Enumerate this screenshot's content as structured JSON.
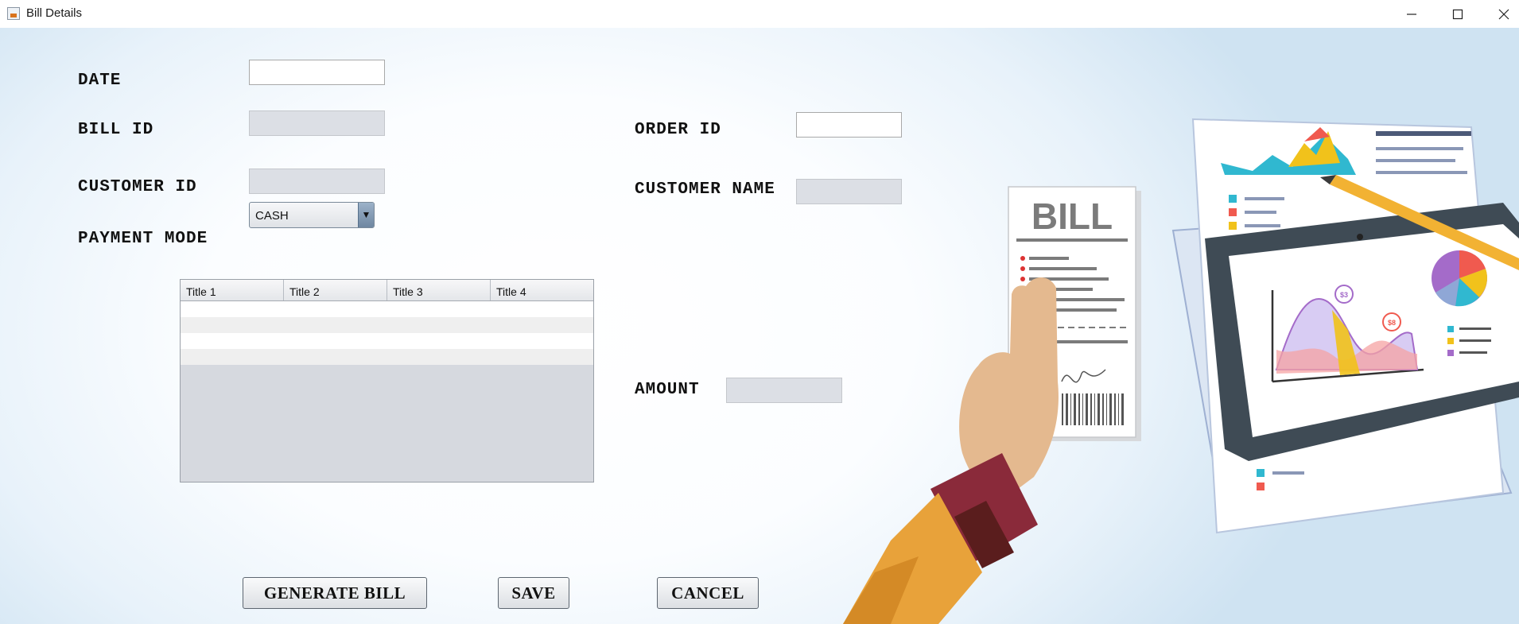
{
  "window": {
    "title": "Bill Details"
  },
  "form": {
    "date_label": "DATE",
    "date_value": "",
    "bill_id_label": "BILL ID",
    "bill_id_value": "",
    "customer_id_label": "CUSTOMER ID",
    "customer_id_value": "",
    "payment_mode_label": "PAYMENT MODE",
    "payment_mode_value": "CASH",
    "order_id_label": "ORDER ID",
    "order_id_value": "",
    "customer_name_label": "CUSTOMER NAME",
    "customer_name_value": "",
    "amount_label": "AMOUNT",
    "amount_value": ""
  },
  "table": {
    "columns": [
      "Title 1",
      "Title 2",
      "Title 3",
      "Title 4"
    ],
    "rows": [
      [
        "",
        "",
        "",
        ""
      ],
      [
        "",
        "",
        "",
        ""
      ],
      [
        "",
        "",
        "",
        ""
      ],
      [
        "",
        "",
        "",
        ""
      ]
    ]
  },
  "buttons": {
    "generate": "GENERATE BILL",
    "save": "SAVE",
    "cancel": "CANCEL"
  },
  "illustration": {
    "bill_heading": "BILL",
    "marker_1": "$3",
    "marker_2": "$8"
  },
  "colors": {
    "accent_orange": "#e8a23a",
    "chart_purple": "#a46bc9",
    "chart_yellow": "#f1c21b",
    "chart_red": "#f05a4f",
    "chart_cyan": "#30b8d0"
  }
}
